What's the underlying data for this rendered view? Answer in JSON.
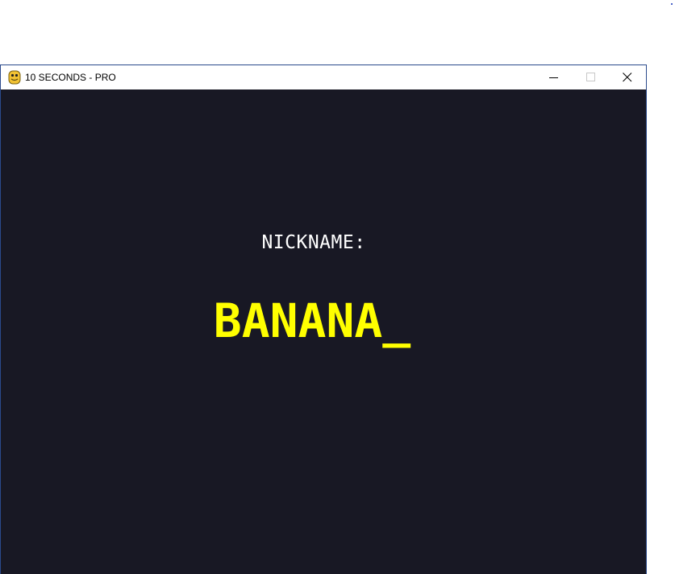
{
  "window": {
    "title": "10 SECONDS - PRO",
    "icon": "python-snake-icon",
    "controls": {
      "minimize": "minimize-icon",
      "maximize": "maximize-icon",
      "close": "close-icon"
    }
  },
  "screen": {
    "background_color": "#181824",
    "label": "NICKNAME:",
    "label_color": "#ffffff",
    "nickname_value": "BANANA",
    "cursor": "_",
    "nickname_color": "#ffff00"
  }
}
